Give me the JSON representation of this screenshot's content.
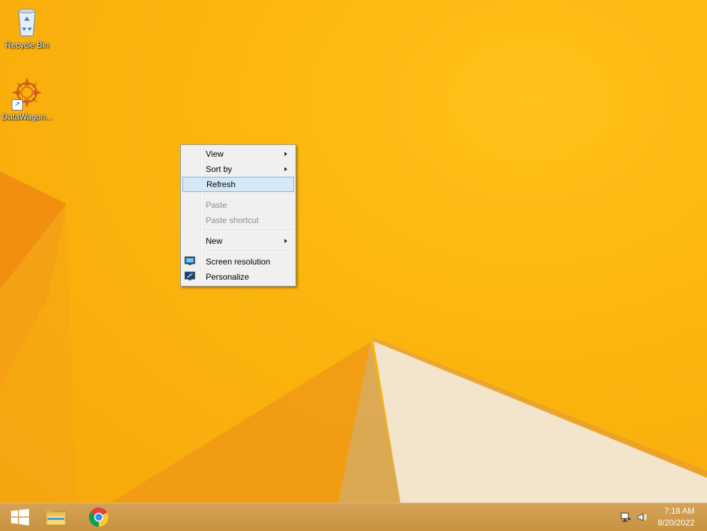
{
  "desktop": {
    "icons": [
      {
        "label": "Recycle Bin",
        "icon": "recycle-bin-icon"
      },
      {
        "label": "DataWagon...",
        "icon": "datawagon-icon"
      }
    ]
  },
  "context_menu": {
    "items": [
      {
        "label": "View",
        "submenu": true,
        "enabled": true
      },
      {
        "label": "Sort by",
        "submenu": true,
        "enabled": true
      },
      {
        "label": "Refresh",
        "submenu": false,
        "enabled": true,
        "highlighted": true
      },
      {
        "label": "Paste",
        "submenu": false,
        "enabled": false
      },
      {
        "label": "Paste shortcut",
        "submenu": false,
        "enabled": false
      },
      {
        "label": "New",
        "submenu": true,
        "enabled": true
      },
      {
        "label": "Screen resolution",
        "submenu": false,
        "enabled": true,
        "icon": "screen-resolution-icon"
      },
      {
        "label": "Personalize",
        "submenu": false,
        "enabled": true,
        "icon": "personalize-icon"
      }
    ]
  },
  "taskbar": {
    "buttons": [
      {
        "icon": "windows-start-icon"
      },
      {
        "icon": "file-explorer-icon"
      },
      {
        "icon": "chrome-icon"
      }
    ],
    "tray": {
      "icons": [
        "network-icon",
        "volume-icon"
      ],
      "time": "7:18 AM",
      "date": "8/20/2022"
    }
  },
  "colors": {
    "wallpaper": "#fbb50e",
    "taskbar": "#c8933f",
    "menu_highlight": "#d5e8f6"
  }
}
